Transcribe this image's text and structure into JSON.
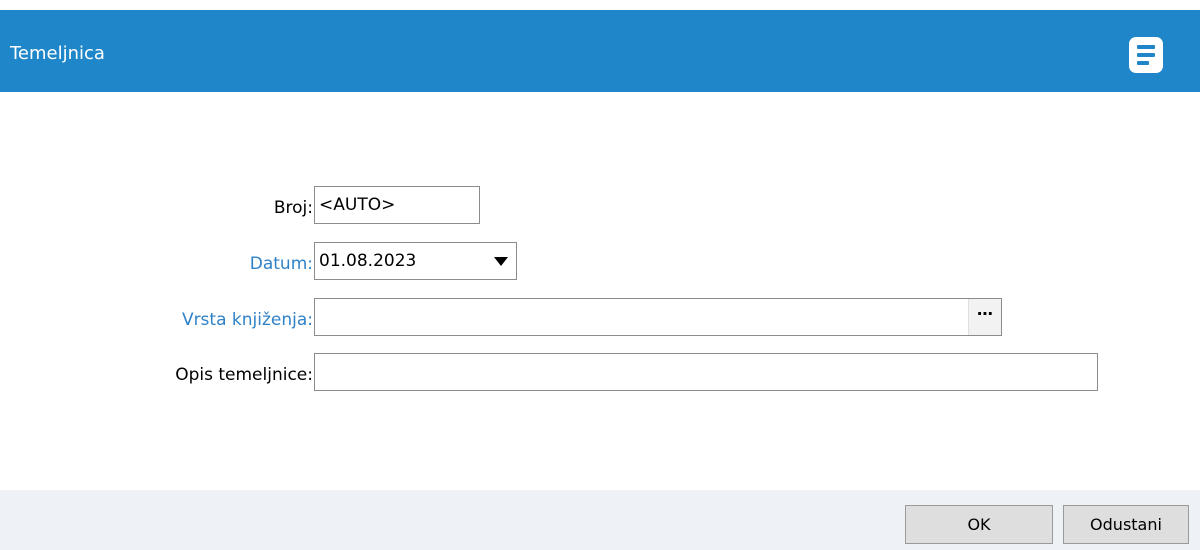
{
  "window": {
    "title": "Temeljnica",
    "menu_icon": "document-list-icon"
  },
  "form": {
    "broj": {
      "label": "Broj:",
      "value": "<AUTO>"
    },
    "datum": {
      "label": "Datum:",
      "value": "01.08.2023"
    },
    "vrsta": {
      "label": "Vrsta knjiženja:",
      "value": "",
      "lookup_label": "⋯"
    },
    "opis": {
      "label": "Opis temeljnice:",
      "value": ""
    }
  },
  "buttons": {
    "ok_label": "OK",
    "cancel_label": "Odustani"
  },
  "colors": {
    "header": "#1f87c9",
    "link_label": "#2f82c8",
    "footer": "#eef2f7"
  }
}
